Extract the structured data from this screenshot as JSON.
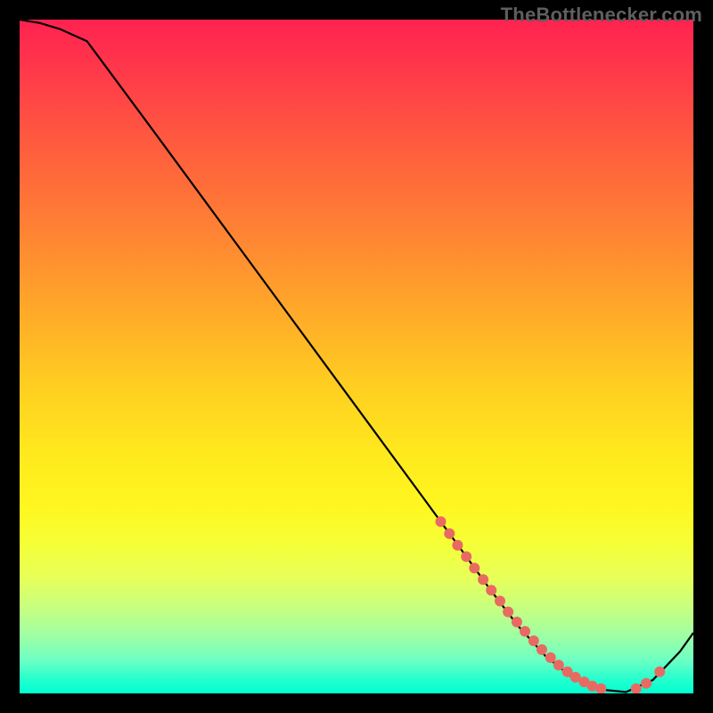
{
  "watermark": "TheBottlenecker.com",
  "chart_data": {
    "type": "line",
    "title": "",
    "xlabel": "",
    "ylabel": "",
    "xlim": [
      0,
      100
    ],
    "ylim": [
      0,
      100
    ],
    "x": [
      0,
      3,
      6,
      10,
      20,
      30,
      40,
      50,
      60,
      66,
      70,
      74,
      78,
      82,
      86,
      90,
      94,
      98,
      100
    ],
    "y": [
      100,
      99.5,
      98.6,
      96.8,
      83.3,
      69.7,
      56.1,
      42.5,
      28.9,
      20.7,
      15.2,
      10.0,
      5.6,
      2.4,
      0.6,
      0.2,
      2.0,
      6.2,
      9.0
    ],
    "marker_points": {
      "x": [
        62.5,
        63.8,
        65.0,
        66.3,
        67.5,
        68.8,
        70.0,
        71.3,
        72.5,
        73.8,
        75.0,
        76.3,
        77.5,
        78.8,
        80.0,
        81.3,
        82.5,
        83.8,
        85.0,
        86.3,
        91.5,
        93.0,
        95.0
      ],
      "y": [
        25.5,
        23.7,
        22.0,
        20.3,
        18.6,
        16.9,
        15.3,
        13.7,
        12.1,
        10.6,
        9.2,
        7.8,
        6.5,
        5.3,
        4.2,
        3.2,
        2.4,
        1.7,
        1.1,
        0.7,
        0.7,
        1.5,
        3.2
      ]
    }
  }
}
